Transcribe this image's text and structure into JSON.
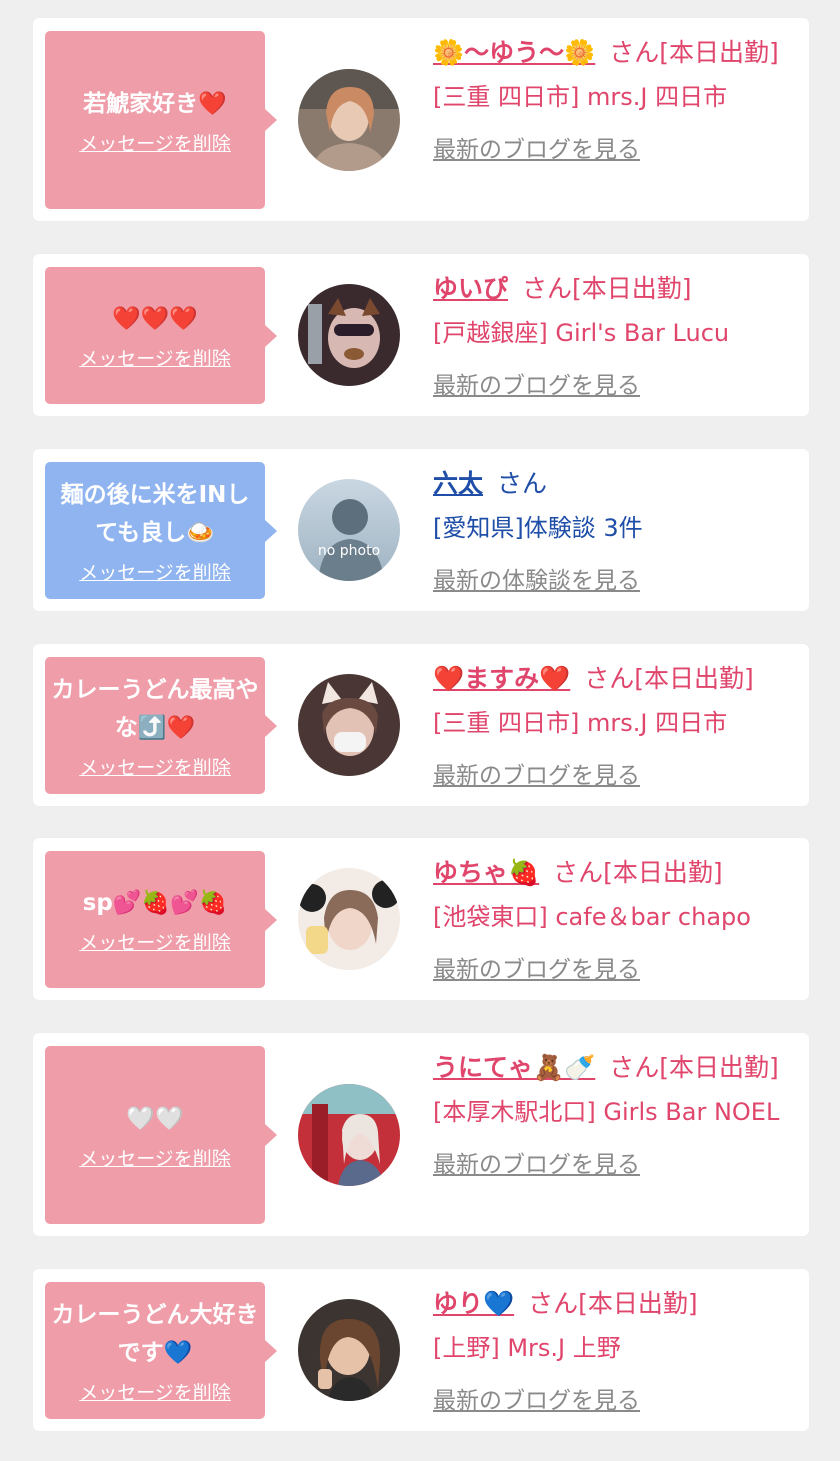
{
  "colors": {
    "pink_bubble": "#ef9da9",
    "blue_bubble": "#8fb4f0",
    "pink_text": "#e0456c",
    "blue_text": "#1f4ea8",
    "link_gray": "#8a8a8a"
  },
  "entries": [
    {
      "message": "若鯱家好き❤️",
      "delete_label": "メッセージを削除",
      "name": "🌼〜ゆう〜🌼",
      "suffix": "さん[本日出勤]",
      "shop": "[三重 四日市] mrs.J 四日市",
      "blog": "最新のブログを見る",
      "avatar_icon": "person-photo-icon"
    },
    {
      "message": "❤️❤️❤️",
      "delete_label": "メッセージを削除",
      "name": "ゆいぴ",
      "suffix": "さん[本日出勤]",
      "shop": "[戸越銀座] Girl's Bar Lucu",
      "blog": "最新のブログを見る",
      "avatar_icon": "person-photo-icon"
    },
    {
      "message": "麺の後に米をINしても良し🍛",
      "delete_label": "メッセージを削除",
      "name": "六太",
      "suffix": "さん",
      "shop": "[愛知県]体験談 3件",
      "blog": "最新の体験談を見る",
      "avatar_icon": "no-photo-silhouette-icon",
      "avatar_text": "no photo"
    },
    {
      "message": "カレーうどん最高やな⤴️❤️",
      "delete_label": "メッセージを削除",
      "name": "❤️ますみ❤️",
      "suffix": "さん[本日出勤]",
      "shop": "[三重 四日市] mrs.J 四日市",
      "blog": "最新のブログを見る",
      "avatar_icon": "person-photo-icon"
    },
    {
      "message": "sp💕🍓💕🍓",
      "delete_label": "メッセージを削除",
      "name": "ゆちゃ🍓",
      "suffix": "さん[本日出勤]",
      "shop": "[池袋東口] cafe＆bar chapo",
      "blog": "最新のブログを見る",
      "avatar_icon": "person-photo-icon"
    },
    {
      "message": "🤍🤍",
      "delete_label": "メッセージを削除",
      "name": "うにてゃ🧸🍼",
      "suffix": "さん[本日出勤]",
      "shop": "[本厚木駅北口] Girls Bar NOEL",
      "blog": "最新のブログを見る",
      "avatar_icon": "person-photo-icon"
    },
    {
      "message": "カレーうどん大好きです💙",
      "delete_label": "メッセージを削除",
      "name": "ゆり💙",
      "suffix": "さん[本日出勤]",
      "shop": "[上野] Mrs.J 上野",
      "blog": "最新のブログを見る",
      "avatar_icon": "person-photo-icon"
    }
  ]
}
